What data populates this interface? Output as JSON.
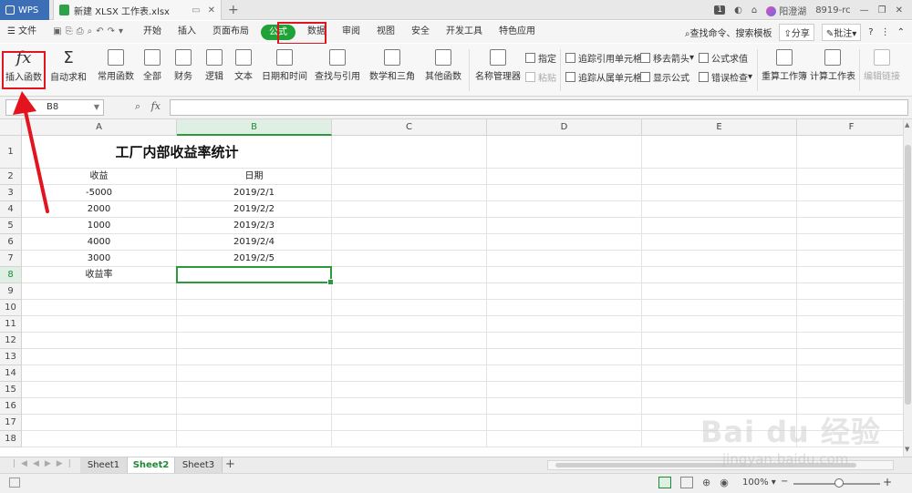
{
  "titlebar": {
    "app_tab": "WPS",
    "doc_tab": "新建 XLSX 工作表.xlsx",
    "new_tab": "+",
    "page_badge": "1",
    "user_name": "阳澄湖",
    "user_id": "8919-rc"
  },
  "menubar": {
    "file": "文件",
    "items": [
      "开始",
      "插入",
      "页面布局",
      "公式",
      "数据",
      "审阅",
      "视图",
      "安全",
      "开发工具",
      "特色应用"
    ],
    "active": "公式",
    "search": "查找命令、搜索模板",
    "share": "分享",
    "comment": "批注"
  },
  "ribbon": {
    "insert_function": "插入函数",
    "autosum": "自动求和",
    "common_functions": "常用函数",
    "all": "全部",
    "financial": "财务",
    "logical": "逻辑",
    "text": "文本",
    "datetime": "日期和时间",
    "lookup": "查找与引用",
    "math": "数学和三角",
    "other": "其他函数",
    "name_manager": "名称管理器",
    "specify": "指定",
    "paste": "粘贴",
    "trace_precedents": "追踪引用单元格",
    "trace_dependents": "追踪从属单元格",
    "remove_arrows": "移去箭头",
    "show_formulas": "显示公式",
    "evaluate": "公式求值",
    "error_check": "错误检查",
    "recalc_book": "重算工作簿",
    "calc_sheet": "计算工作表",
    "edit_links": "编辑链接"
  },
  "formula_bar": {
    "name_box": "B8",
    "fx": "fx",
    "content": ""
  },
  "sheet": {
    "columns": [
      "A",
      "B",
      "C",
      "D",
      "E",
      "F"
    ],
    "rows": [
      "1",
      "2",
      "3",
      "4",
      "5",
      "6",
      "7",
      "8",
      "9",
      "10",
      "11",
      "12",
      "13",
      "14",
      "15",
      "16",
      "17",
      "18"
    ],
    "title": "工厂内部收益率统计",
    "headers": {
      "a": "收益",
      "b": "日期"
    },
    "data": [
      {
        "a": "-5000",
        "b": "2019/2/1"
      },
      {
        "a": "2000",
        "b": "2019/2/2"
      },
      {
        "a": "1000",
        "b": "2019/2/3"
      },
      {
        "a": "4000",
        "b": "2019/2/4"
      },
      {
        "a": "3000",
        "b": "2019/2/5"
      }
    ],
    "row8_label": "收益率",
    "active_cell": "B8"
  },
  "sheet_tabs": [
    "Sheet1",
    "Sheet2",
    "Sheet3"
  ],
  "active_sheet": "Sheet2",
  "statusbar": {
    "zoom": "100%"
  },
  "watermark": {
    "main": "Bai du 经验",
    "sub": "jingyan.baidu.com"
  },
  "colors": {
    "accent_green": "#1fa336",
    "highlight_red": "#e3141e",
    "wps_blue": "#3d6fb6"
  }
}
